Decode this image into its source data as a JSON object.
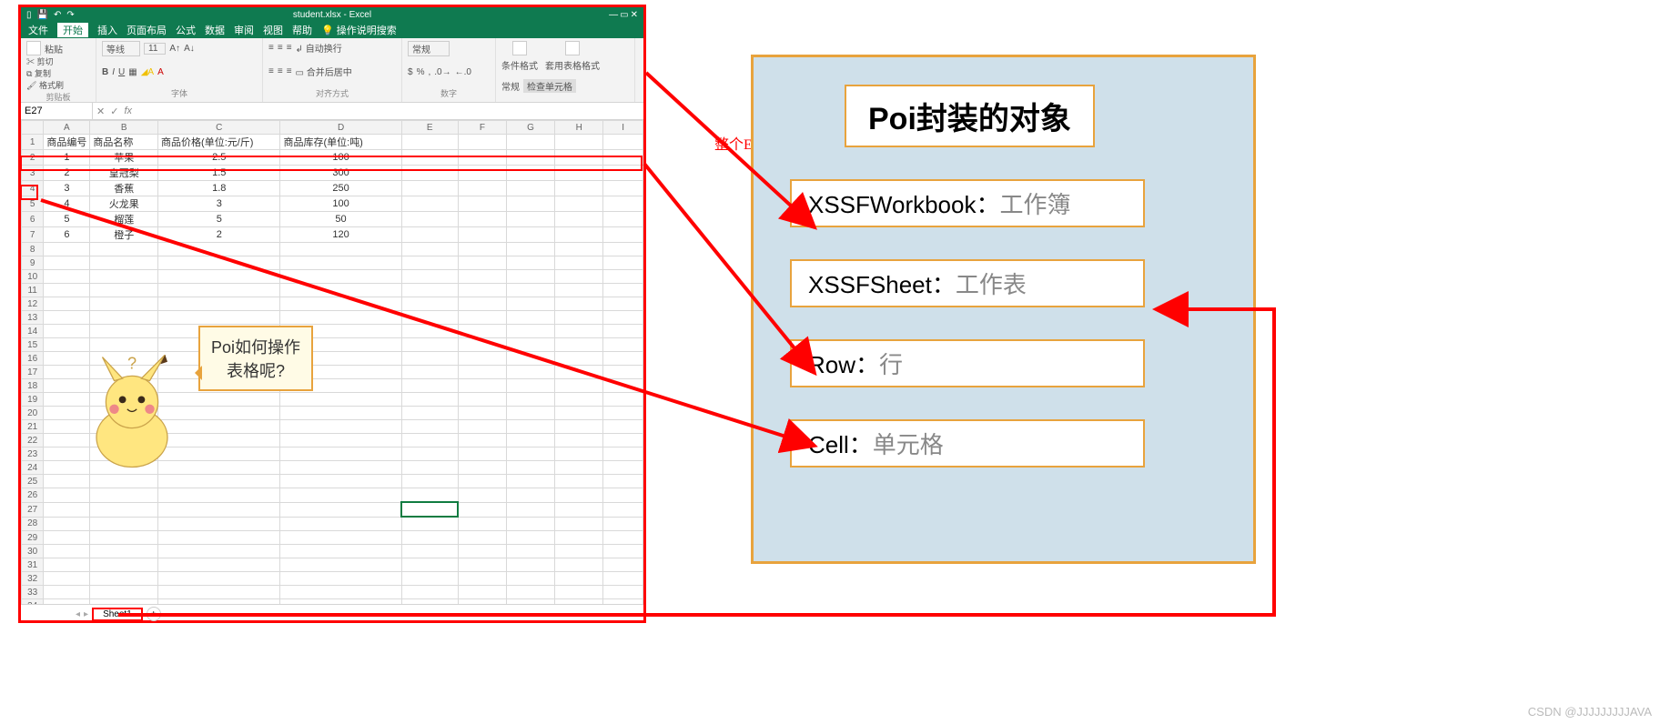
{
  "window": {
    "title": "student.xlsx - Excel",
    "qat": [
      "save-icon",
      "undo-icon",
      "redo-icon"
    ],
    "menus": {
      "file": "文件",
      "home": "开始",
      "insert": "插入",
      "layout": "页面布局",
      "formula": "公式",
      "data": "数据",
      "review": "审阅",
      "view": "视图",
      "help": "帮助",
      "tell": "操作说明搜索"
    }
  },
  "ribbon": {
    "clipboard": {
      "paste": "粘贴",
      "cut": "剪切",
      "copy": "复制",
      "brush": "格式刷",
      "label": "剪贴板"
    },
    "font": {
      "family": "等线",
      "size": "11",
      "label": "字体"
    },
    "align": {
      "wrap": "自动换行",
      "merge": "合并后居中",
      "label": "对齐方式"
    },
    "number": {
      "format": "常规",
      "label": "数字"
    },
    "styles": {
      "cond": "条件格式",
      "table": "套用表格格式",
      "check": "检查单元格",
      "label": ""
    },
    "general": {
      "label": "常规"
    }
  },
  "namebox": "E27",
  "columns": [
    "A",
    "B",
    "C",
    "D",
    "E",
    "F",
    "G",
    "H",
    "I"
  ],
  "headers": {
    "a": "商品编号",
    "b": "商品名称",
    "c": "商品价格(单位:元/斤)",
    "d": "商品库存(单位:吨)"
  },
  "rows": [
    {
      "n": "1",
      "a": "1",
      "b": "苹果",
      "c": "2.5",
      "d": "100"
    },
    {
      "n": "2",
      "a": "2",
      "b": "皇冠梨",
      "c": "1.5",
      "d": "300"
    },
    {
      "n": "3",
      "a": "3",
      "b": "香蕉",
      "c": "1.8",
      "d": "250"
    },
    {
      "n": "4",
      "a": "4",
      "b": "火龙果",
      "c": "3",
      "d": "100"
    },
    {
      "n": "5",
      "a": "5",
      "b": "榴莲",
      "c": "5",
      "d": "50"
    },
    {
      "n": "6",
      "a": "6",
      "b": "橙子",
      "c": "2",
      "d": "120"
    }
  ],
  "sheet_tab": "Sheet1",
  "callout": {
    "l1": "Poi如何操作",
    "l2": "表格呢?"
  },
  "rednote": "整个Excel文档",
  "panel": {
    "title": "Poi封装的对象",
    "items": [
      {
        "en": "XSSFWorkbook：",
        "zh": "工作簿"
      },
      {
        "en": "XSSFSheet：",
        "zh": "工作表"
      },
      {
        "en": "Row：",
        "zh": "行"
      },
      {
        "en": "Cell：",
        "zh": "单元格"
      }
    ]
  },
  "watermark": "CSDN @JJJJJJJJJAVA"
}
